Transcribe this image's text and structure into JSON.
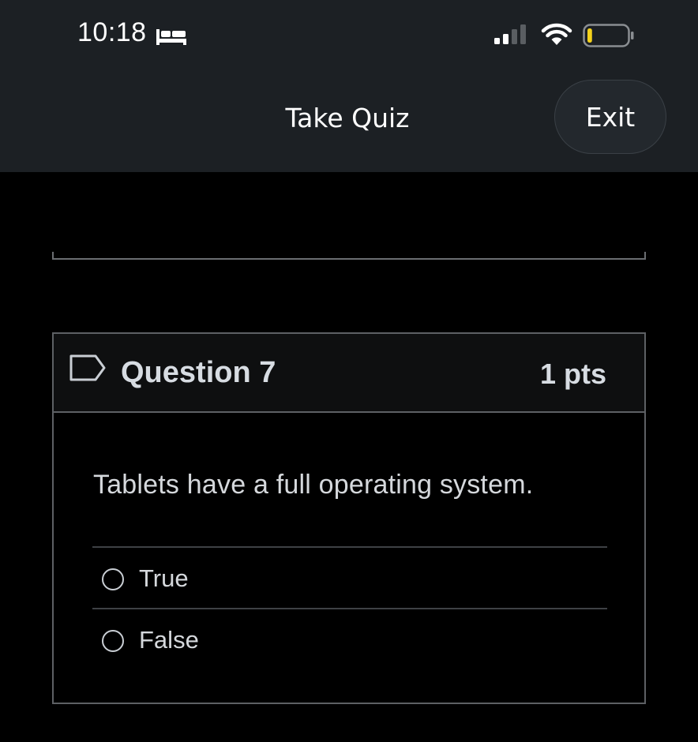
{
  "status_bar": {
    "time": "10:18",
    "icons": [
      "bed-icon",
      "signal-icon",
      "wifi-icon",
      "battery-icon"
    ],
    "battery_level": 0.12,
    "battery_color": "#f5d21b"
  },
  "nav": {
    "title": "Take Quiz",
    "exit_label": "Exit"
  },
  "question": {
    "title": "Question 7",
    "points": "1 pts",
    "flag_icon": "bookmark-flag-icon",
    "text": "Tablets have a full operating system.",
    "answers": [
      {
        "label": "True",
        "selected": false
      },
      {
        "label": "False",
        "selected": false
      }
    ]
  },
  "colors": {
    "topbar_bg": "#1c2024",
    "page_bg": "#000000",
    "card_border": "#5d6064",
    "text": "#d5d8dc"
  }
}
